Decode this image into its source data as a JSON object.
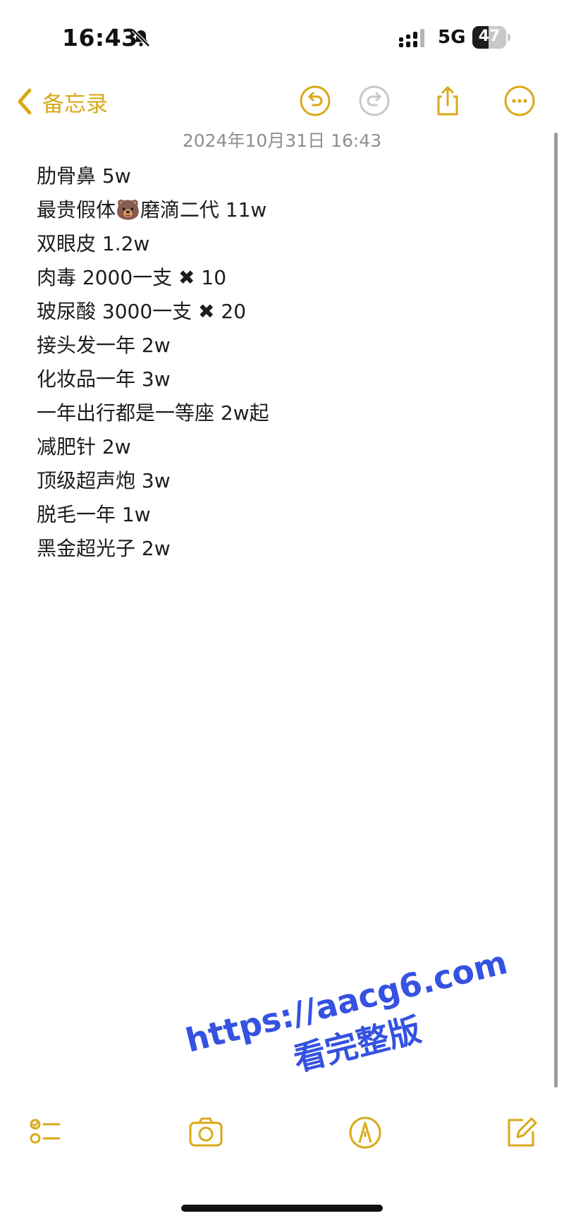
{
  "status_bar": {
    "time": "16:43",
    "network": "5G",
    "battery": "47",
    "battery_level": 0.47
  },
  "nav": {
    "back_label": "备忘录"
  },
  "note": {
    "date": "2024年10月31日 16:43",
    "lines": [
      "肋骨鼻 5w",
      "最贵假体🐻磨滴二代 11w",
      "双眼皮 1.2w",
      "肉毒 2000一支 ✖ 10",
      "玻尿酸 3000一支 ✖ 20",
      "接头发一年 2w",
      "化妆品一年 3w",
      "一年出行都是一等座 2w起",
      "减肥针 2w",
      "顶级超声炮 3w",
      "脱毛一年 1w",
      "黑金超光子 2w"
    ]
  },
  "watermark": {
    "url": "https://aacg6.com",
    "text": "看完整版"
  },
  "colors": {
    "accent": "#d9a91a",
    "date_gray": "#8e8e93",
    "watermark_blue": "#3552e0"
  },
  "icons": [
    "bell-slash-icon",
    "signal-icon",
    "chevron-left-icon",
    "undo-icon",
    "redo-icon",
    "share-icon",
    "more-icon",
    "checklist-icon",
    "camera-icon",
    "markup-icon",
    "compose-icon"
  ]
}
